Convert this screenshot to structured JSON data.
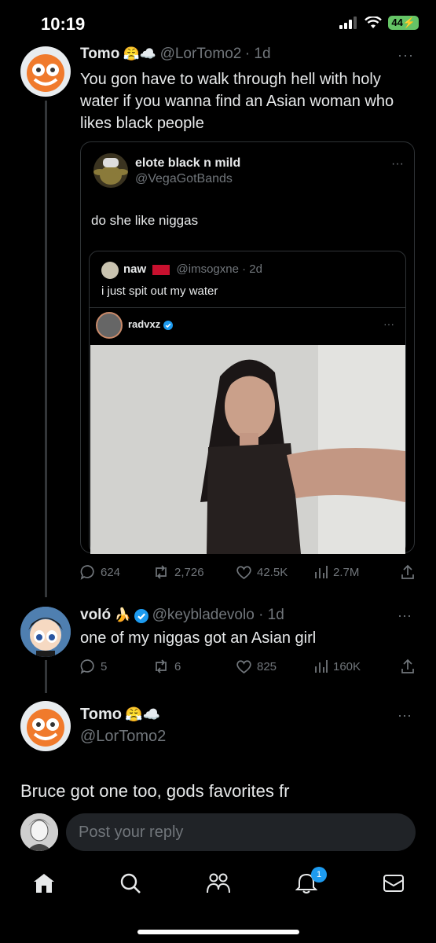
{
  "status_bar": {
    "time": "10:19",
    "battery": "44"
  },
  "main_tweet": {
    "name": "Tomo",
    "name_emoji": "😤☁️",
    "handle": "@LorTomo2",
    "time": "· 1d",
    "text": "You gon have to walk through hell with holy water if you wanna find an Asian woman who likes black people"
  },
  "quote1": {
    "name": "elote black n mild",
    "handle": "@VegaGotBands",
    "text": "do she like niggas"
  },
  "quote2": {
    "name": "naw",
    "handle": "@imsogxne · 2d",
    "text": "i just spit out my water"
  },
  "quote3": {
    "name": "radvxz"
  },
  "main_actions": {
    "replies": "624",
    "reposts": "2,726",
    "likes": "42.5K",
    "views": "2.7M"
  },
  "reply_tweet": {
    "name": "voló",
    "name_emoji": "🍌",
    "handle": "@keybladevolo · 1d",
    "text": "one of my niggas got an Asian girl",
    "replies": "5",
    "reposts": "6",
    "likes": "825",
    "views": "160K"
  },
  "focused_tweet": {
    "name": "Tomo",
    "name_emoji": "😤☁️",
    "handle": "@LorTomo2",
    "text": "Bruce got one too, gods favorites fr"
  },
  "reply_input": {
    "placeholder": "Post your reply"
  },
  "nav": {
    "notification_count": "1"
  },
  "colors": {
    "accent": "#1d9bf0",
    "background": "#000000",
    "muted": "#71767b"
  }
}
